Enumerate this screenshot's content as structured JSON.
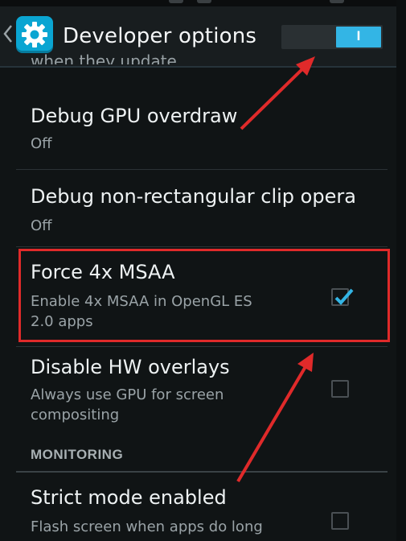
{
  "header": {
    "title": "Developer options",
    "switch_label": "I",
    "switch_state": "on"
  },
  "clipped_summary": "when they update",
  "prefs": [
    {
      "title": "Debug GPU overdraw",
      "summary": "Off",
      "has_checkbox": false
    },
    {
      "title": "Debug non-rectangular clip opera",
      "summary": "Off",
      "has_checkbox": false
    },
    {
      "title": "Force 4x MSAA",
      "summary_lines": [
        "Enable 4x MSAA in OpenGL ES",
        "2.0 apps"
      ],
      "checked": true
    },
    {
      "title": "Disable HW overlays",
      "summary_lines": [
        "Always use GPU for screen",
        "compositing"
      ],
      "checked": false
    },
    {
      "title": "Strict mode enabled",
      "summary_lines": [
        "Flash screen when apps do long"
      ],
      "checked": false
    }
  ],
  "section": {
    "monitoring": "MONITORING"
  },
  "colors": {
    "accent": "#33b5e5",
    "icon_bg": "#0aa5d2",
    "highlight": "#e02a2a",
    "background": "#101415"
  },
  "icons": {
    "back": "chevron-left-icon",
    "settings": "gear-icon",
    "check": "check-icon"
  }
}
